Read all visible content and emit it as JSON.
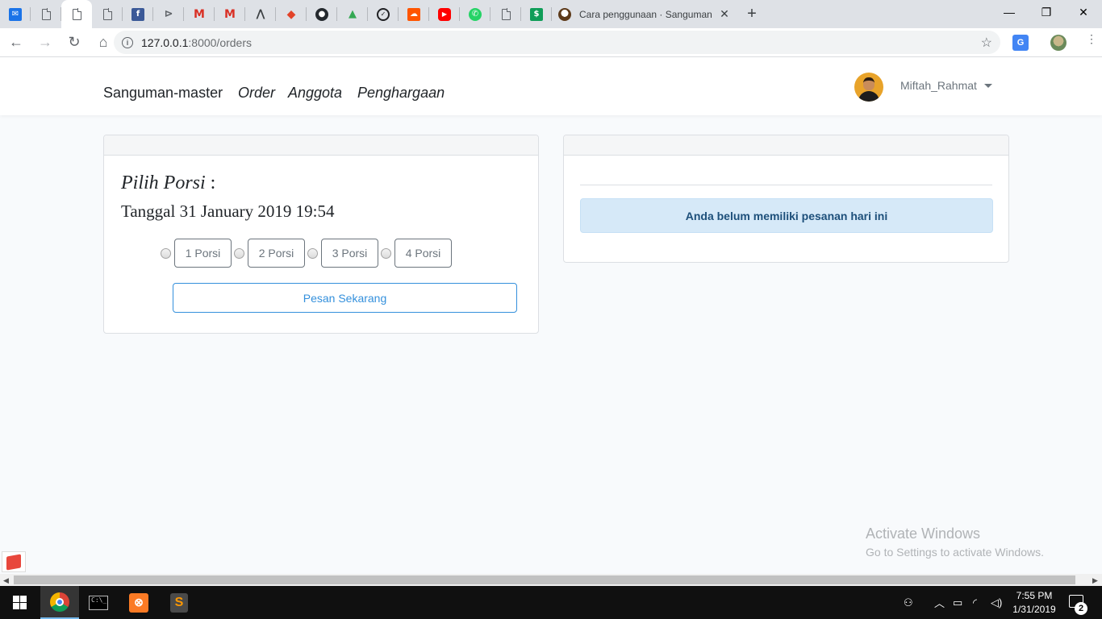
{
  "browser": {
    "tabs": {
      "active_title": "Cara penggunaan · Sanguman",
      "close": "✕",
      "new_tab": "+"
    },
    "window_controls": {
      "minimize": "—",
      "maximize": "❐",
      "close": "✕"
    },
    "address": {
      "host": "127.0.0.1",
      "path": ":8000/orders"
    }
  },
  "navbar": {
    "brand": "Sanguman-master",
    "links": [
      "Order",
      "Anggota",
      "Penghargaan"
    ],
    "user_name": "Miftah_Rahmat"
  },
  "order_card": {
    "title_italic": "Pilih Porsi",
    "title_suffix": " :",
    "date_line": "Tanggal 31 January 2019 19:54",
    "portions": [
      "1 Porsi",
      "2 Porsi",
      "3 Porsi",
      "4 Porsi"
    ],
    "submit_label": "Pesan Sekarang"
  },
  "status_card": {
    "alert_text": "Anda belum memiliki pesanan hari ini"
  },
  "watermark": {
    "line1": "Activate Windows",
    "line2": "Go to Settings to activate Windows."
  },
  "taskbar": {
    "time": "7:55 PM",
    "date": "1/31/2019",
    "notification_count": "2"
  }
}
